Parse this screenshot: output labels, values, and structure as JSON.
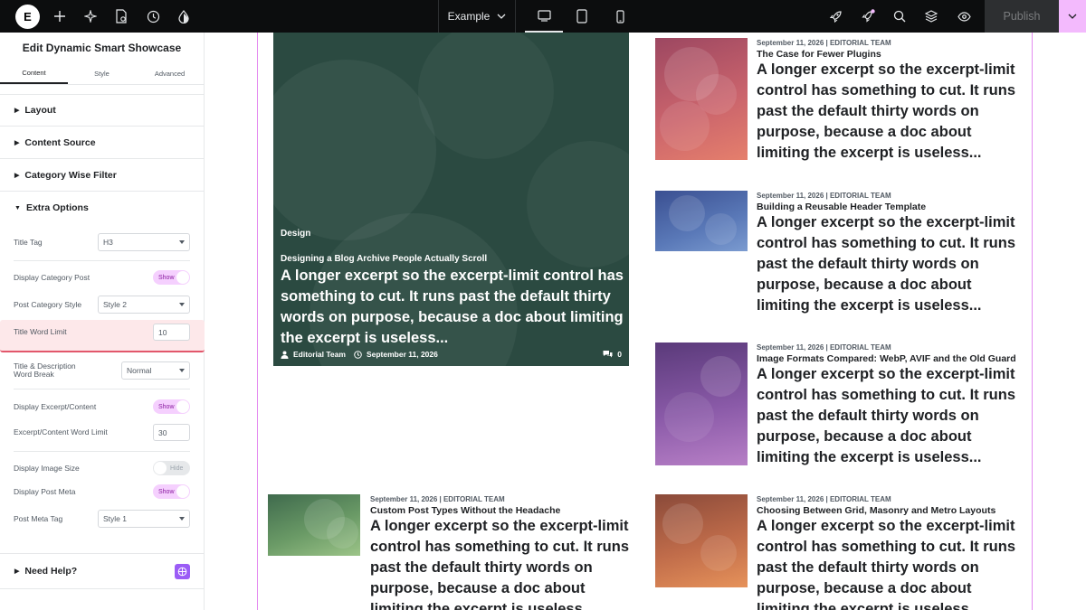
{
  "topbar": {
    "page_name": "Example",
    "publish_label": "Publish",
    "icons": [
      "add-icon",
      "ai-sparkle-icon",
      "page-settings-icon",
      "history-icon",
      "theme-icon",
      "rocket-icon",
      "notifications-icon",
      "search-icon",
      "structure-icon",
      "preview-icon"
    ]
  },
  "panel": {
    "title": "Edit Dynamic Smart Showcase",
    "tabs": [
      "Content",
      "Style",
      "Advanced"
    ],
    "sections": [
      "Layout",
      "Content Source",
      "Category Wise Filter",
      "Extra Options"
    ],
    "controls": {
      "title_tag": {
        "label": "Title Tag",
        "value": "H3"
      },
      "display_category_post": {
        "label": "Display Category Post",
        "value": "Show"
      },
      "post_category_style": {
        "label": "Post Category Style",
        "value": "Style 2"
      },
      "title_word_limit": {
        "label": "Title Word Limit",
        "value": "10"
      },
      "word_break": {
        "label": "Title & Description Word Break",
        "value": "Normal"
      },
      "display_excerpt": {
        "label": "Display Excerpt/Content",
        "value": "Show"
      },
      "excerpt_word_limit": {
        "label": "Excerpt/Content Word Limit",
        "value": "30"
      },
      "display_image_size": {
        "label": "Display Image Size",
        "value": "Hide"
      },
      "display_post_meta": {
        "label": "Display Post Meta",
        "value": "Show"
      },
      "post_meta_tag": {
        "label": "Post Meta Tag",
        "value": "Style 1"
      }
    },
    "help": "Need Help?"
  },
  "hero": {
    "category": "Design",
    "title": "Designing a Blog Archive People Actually Scroll",
    "excerpt": "A longer excerpt so the excerpt-limit control has something to cut. It runs past the default thirty words on purpose, because a doc about limiting the excerpt is useless...",
    "author": "Editorial Team",
    "date": "September 11, 2026",
    "comments": "0"
  },
  "cards": [
    {
      "meta": "September 11, 2026 | EDITORIAL TEAM",
      "title": "The Case for Fewer Plugins",
      "excerpt": "A longer excerpt so the excerpt-limit control has something to cut. It runs past the default thirty words on purpose, because a doc about limiting the excerpt is useless..."
    },
    {
      "meta": "September 11, 2026 | EDITORIAL TEAM",
      "title": "Building a Reusable Header Template",
      "excerpt": "A longer excerpt so the excerpt-limit control has something to cut. It runs past the default thirty words on purpose, because a doc about limiting the excerpt is useless..."
    },
    {
      "meta": "September 11, 2026 | EDITORIAL TEAM",
      "title": "Image Formats Compared: WebP, AVIF and the Old Guard",
      "excerpt": "A longer excerpt so the excerpt-limit control has something to cut. It runs past the default thirty words on purpose, because a doc about limiting the excerpt is useless..."
    },
    {
      "meta": "September 11, 2026 | EDITORIAL TEAM",
      "title": "Custom Post Types Without the Headache",
      "excerpt": "A longer excerpt so the excerpt-limit control has something to cut. It runs past the default thirty words on purpose, because a doc about limiting the excerpt is useless..."
    },
    {
      "meta": "September 11, 2026 | EDITORIAL TEAM",
      "title": "Choosing Between Grid, Masonry and Metro Layouts",
      "excerpt": "A longer excerpt so the excerpt-limit control has something to cut. It runs past the default thirty words on purpose, because a doc about limiting the excerpt is useless..."
    }
  ],
  "colors": {
    "accent": "#f3bafd",
    "highlight": "#e2576b",
    "hero_bg": "#2b4a41"
  }
}
